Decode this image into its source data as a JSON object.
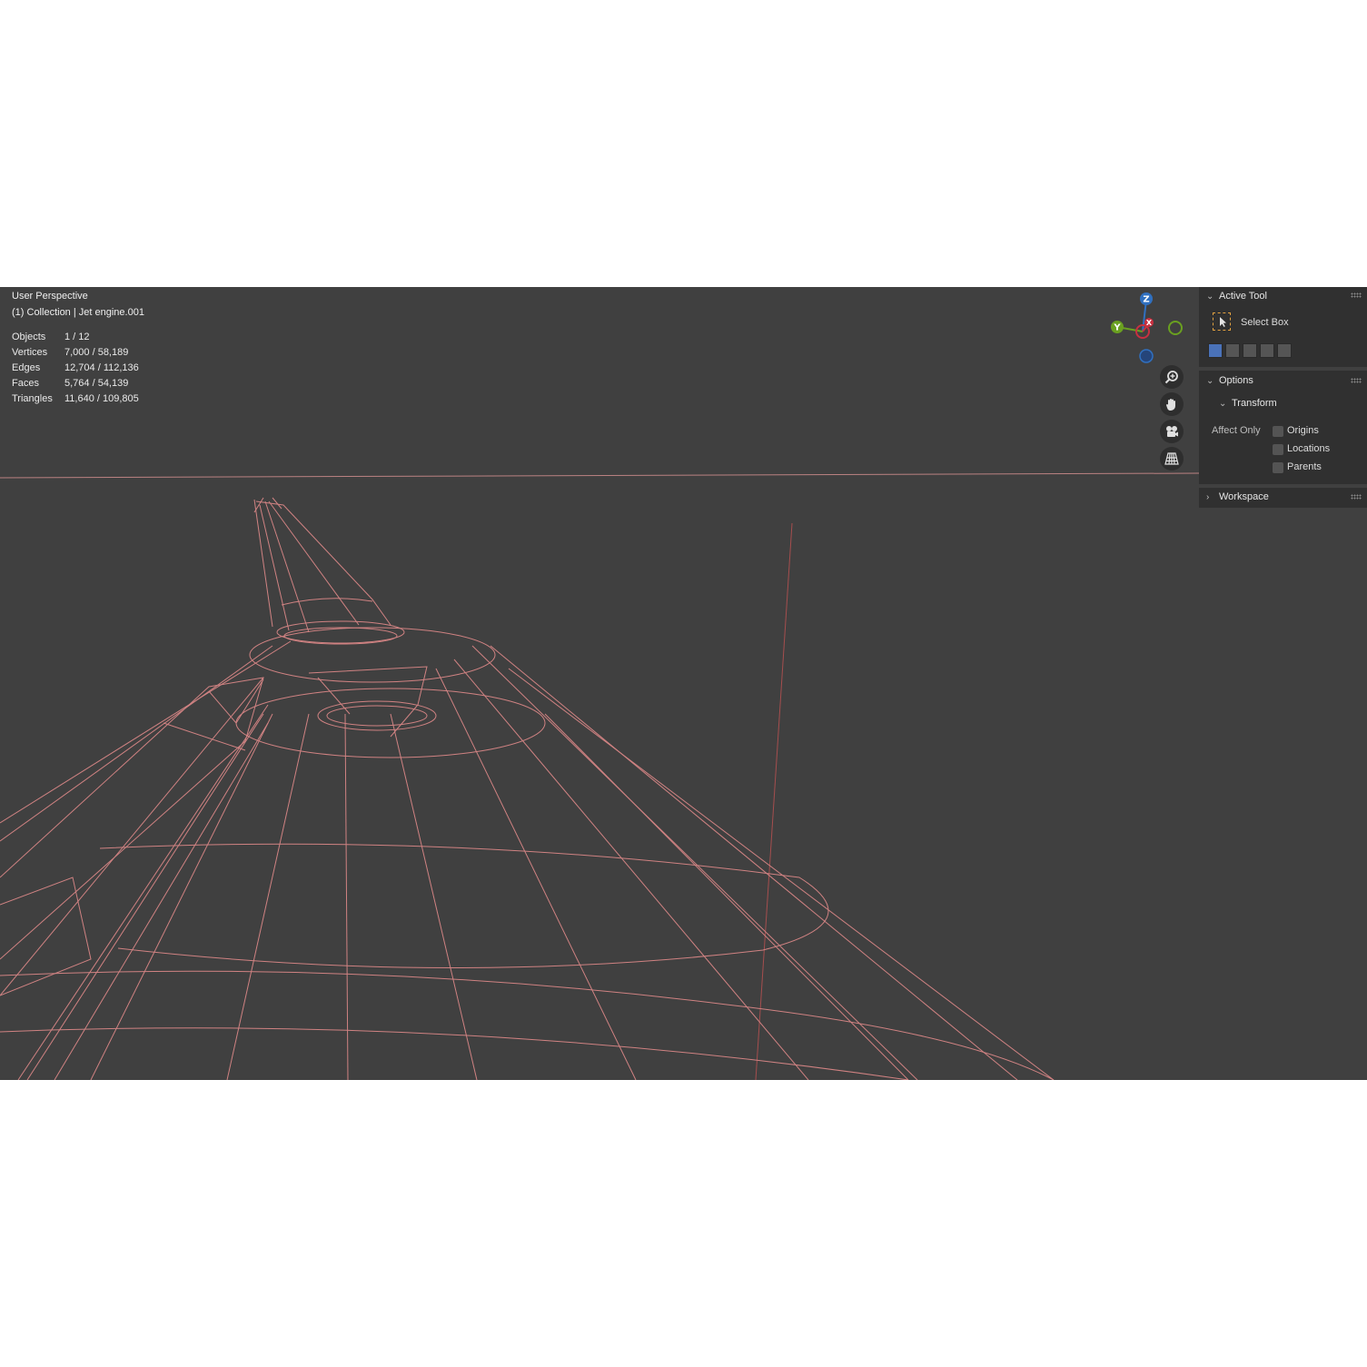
{
  "viewport": {
    "view_name": "User Perspective",
    "collection_line": "(1) Collection | Jet engine.001",
    "stats": [
      {
        "label": "Objects",
        "value": "1 / 12"
      },
      {
        "label": "Vertices",
        "value": "7,000 / 58,189"
      },
      {
        "label": "Edges",
        "value": "12,704 / 112,136"
      },
      {
        "label": "Faces",
        "value": "5,764 / 54,139"
      },
      {
        "label": "Triangles",
        "value": "11,640 / 109,805"
      }
    ],
    "wire_color": "#e08a8a",
    "background_color": "#404040"
  },
  "gizmo": {
    "z_label": "Z",
    "y_label": "Y",
    "x_label": "X",
    "x_color": "#c83040",
    "y_color": "#6aa020",
    "z_color": "#3070c0"
  },
  "nav_buttons": [
    {
      "icon": "zoom-icon"
    },
    {
      "icon": "hand-pan-icon"
    },
    {
      "icon": "camera-icon"
    },
    {
      "icon": "grid-ortho-icon"
    }
  ],
  "sidebar": {
    "active_tool_title": "Active Tool",
    "tool_name": "Select Box",
    "options_title": "Options",
    "transform_title": "Transform",
    "affect_only_label": "Affect Only",
    "checkboxes": [
      {
        "label": "Origins",
        "checked": false
      },
      {
        "label": "Locations",
        "checked": false
      },
      {
        "label": "Parents",
        "checked": false
      }
    ],
    "workspace_title": "Workspace"
  }
}
